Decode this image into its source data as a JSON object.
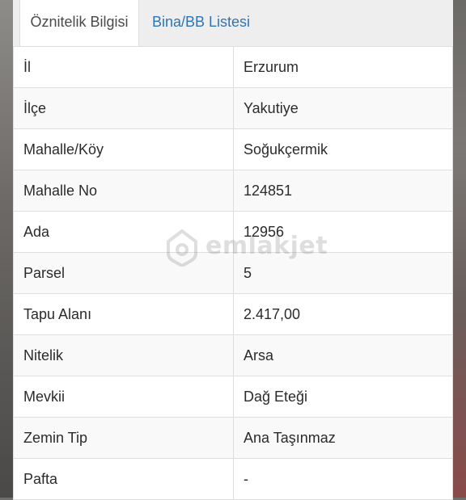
{
  "tabs": [
    {
      "label": "Öznitelik Bilgisi",
      "active": true
    },
    {
      "label": "Bina/BB Listesi",
      "active": false
    }
  ],
  "attributes": [
    {
      "key": "İl",
      "value": "Erzurum"
    },
    {
      "key": "İlçe",
      "value": "Yakutiye"
    },
    {
      "key": "Mahalle/Köy",
      "value": "Soğukçermik"
    },
    {
      "key": "Mahalle No",
      "value": "124851"
    },
    {
      "key": "Ada",
      "value": "12956"
    },
    {
      "key": "Parsel",
      "value": "5"
    },
    {
      "key": "Tapu Alanı",
      "value": "2.417,00"
    },
    {
      "key": "Nitelik",
      "value": "Arsa"
    },
    {
      "key": "Mevkii",
      "value": "Dağ Eteği"
    },
    {
      "key": "Zemin Tip",
      "value": "Ana Taşınmaz"
    },
    {
      "key": "Pafta",
      "value": "-"
    }
  ],
  "watermark": {
    "text": "emlakjet",
    "icon": "home-pin-icon"
  },
  "colors": {
    "active_tab_text": "#4a4a4a",
    "inactive_tab_text": "#2f75b5",
    "tab_bar_bg": "#eeeeee",
    "row_alt_bg": "#f9f9f9",
    "border": "#dedede"
  }
}
